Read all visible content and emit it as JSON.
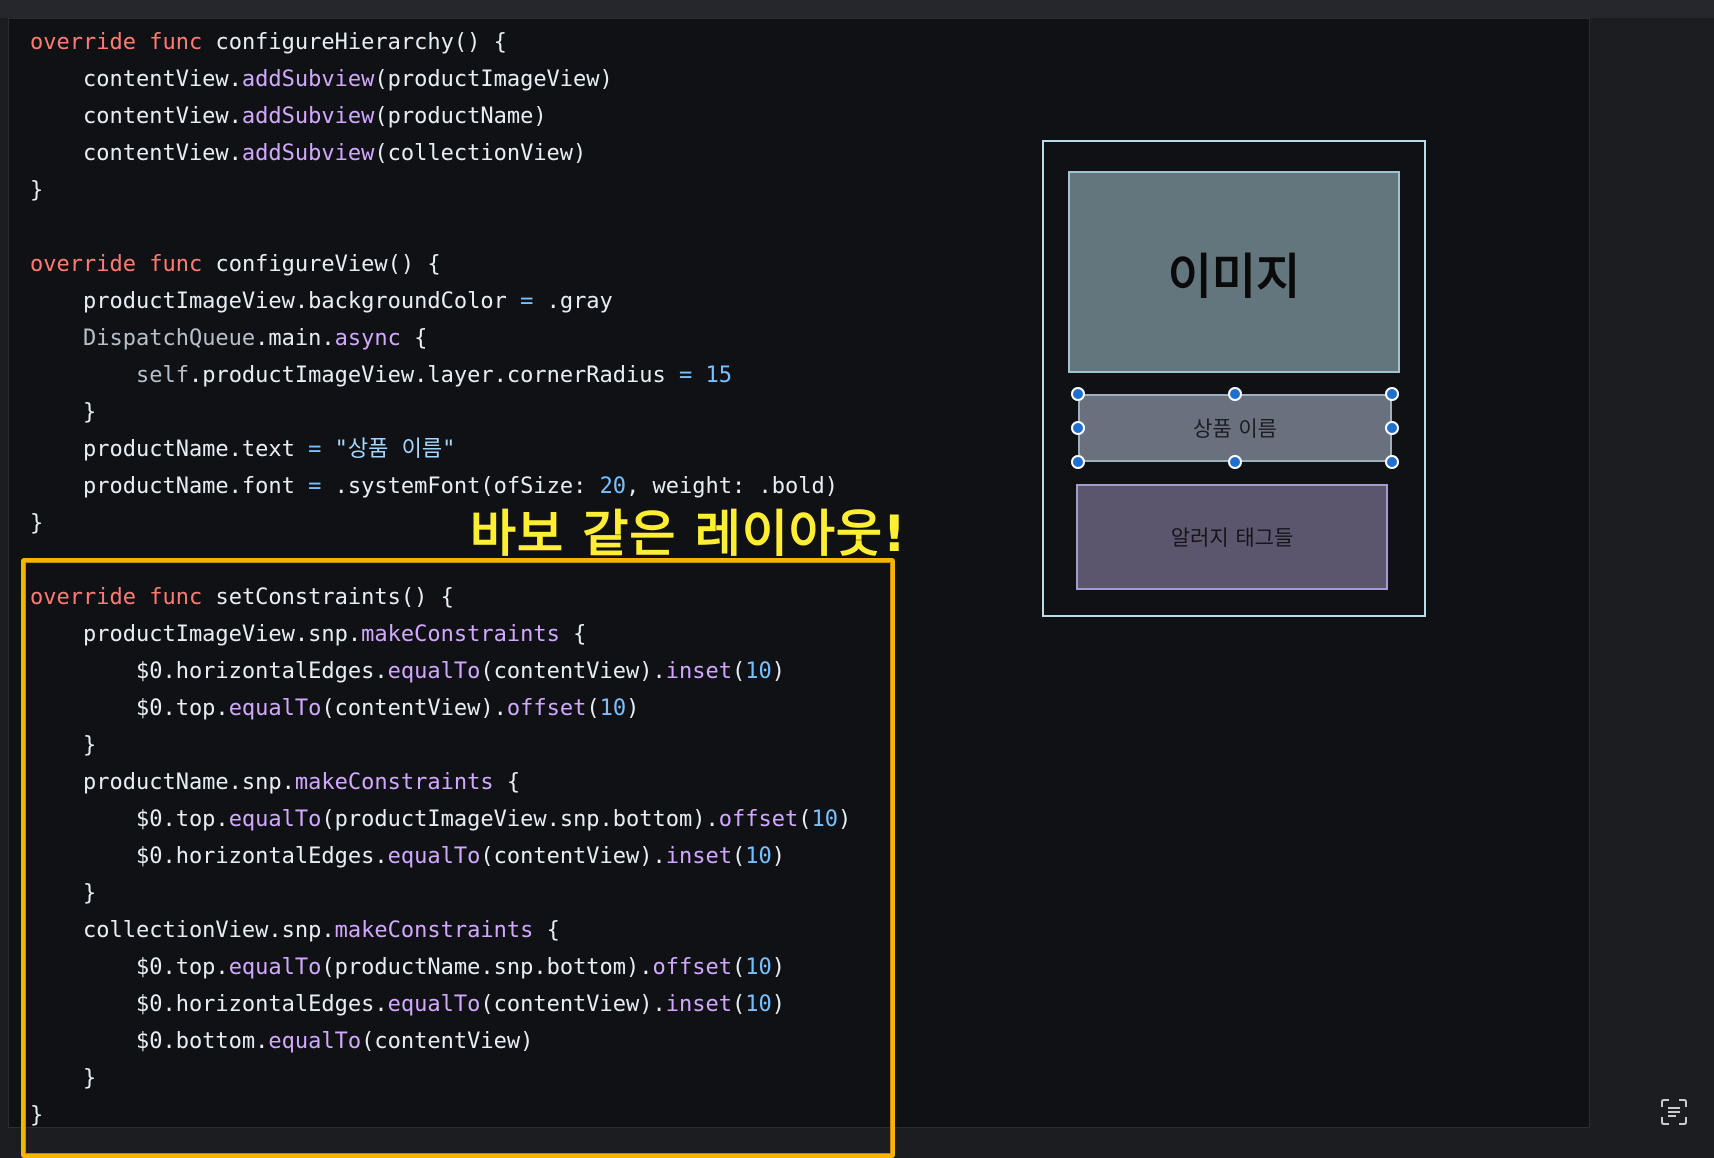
{
  "code_lines": [
    [
      [
        "kw",
        "override"
      ],
      [
        "t",
        " "
      ],
      [
        "kw",
        "func"
      ],
      [
        "t",
        " configureHierarchy() {"
      ]
    ],
    [
      [
        "t",
        "    contentView."
      ],
      [
        "fn",
        "addSubview"
      ],
      [
        "t",
        "(productImageView)"
      ]
    ],
    [
      [
        "t",
        "    contentView."
      ],
      [
        "fn",
        "addSubview"
      ],
      [
        "t",
        "(productName)"
      ]
    ],
    [
      [
        "t",
        "    contentView."
      ],
      [
        "fn",
        "addSubview"
      ],
      [
        "t",
        "(collectionView)"
      ]
    ],
    [
      [
        "t",
        "}"
      ]
    ],
    [
      [
        "t",
        ""
      ]
    ],
    [
      [
        "kw",
        "override"
      ],
      [
        "t",
        " "
      ],
      [
        "kw",
        "func"
      ],
      [
        "t",
        " configureView() {"
      ]
    ],
    [
      [
        "t",
        "    productImageView.backgroundColor "
      ],
      [
        "op",
        "="
      ],
      [
        "t",
        " .gray"
      ]
    ],
    [
      [
        "t",
        "    "
      ],
      [
        "sys",
        "DispatchQueue"
      ],
      [
        "t",
        ".main."
      ],
      [
        "fn",
        "async"
      ],
      [
        "t",
        " {"
      ]
    ],
    [
      [
        "t",
        "        "
      ],
      [
        "sys",
        "self"
      ],
      [
        "t",
        ".productImageView.layer.cornerRadius "
      ],
      [
        "op",
        "="
      ],
      [
        "t",
        " "
      ],
      [
        "num",
        "15"
      ]
    ],
    [
      [
        "t",
        "    }"
      ]
    ],
    [
      [
        "t",
        "    productName.text "
      ],
      [
        "op",
        "="
      ],
      [
        "t",
        " "
      ],
      [
        "str",
        "\"상품 이름\""
      ]
    ],
    [
      [
        "t",
        "    productName.font "
      ],
      [
        "op",
        "="
      ],
      [
        "t",
        " .systemFont(ofSize: "
      ],
      [
        "num",
        "20"
      ],
      [
        "t",
        ", weight: .bold)"
      ]
    ],
    [
      [
        "t",
        "}"
      ]
    ],
    [
      [
        "t",
        ""
      ]
    ],
    [
      [
        "kw",
        "override"
      ],
      [
        "t",
        " "
      ],
      [
        "kw",
        "func"
      ],
      [
        "t",
        " setConstraints() {"
      ]
    ],
    [
      [
        "t",
        "    productImageView.snp."
      ],
      [
        "fn",
        "makeConstraints"
      ],
      [
        "t",
        " {"
      ]
    ],
    [
      [
        "t",
        "        $0.horizontalEdges."
      ],
      [
        "fn",
        "equalTo"
      ],
      [
        "t",
        "(contentView)."
      ],
      [
        "fn",
        "inset"
      ],
      [
        "t",
        "("
      ],
      [
        "num",
        "10"
      ],
      [
        "t",
        ")"
      ]
    ],
    [
      [
        "t",
        "        $0.top."
      ],
      [
        "fn",
        "equalTo"
      ],
      [
        "t",
        "(contentView)."
      ],
      [
        "fn",
        "offset"
      ],
      [
        "t",
        "("
      ],
      [
        "num",
        "10"
      ],
      [
        "t",
        ")"
      ]
    ],
    [
      [
        "t",
        "    }"
      ]
    ],
    [
      [
        "t",
        "    productName.snp."
      ],
      [
        "fn",
        "makeConstraints"
      ],
      [
        "t",
        " {"
      ]
    ],
    [
      [
        "t",
        "        $0.top."
      ],
      [
        "fn",
        "equalTo"
      ],
      [
        "t",
        "(productImageView.snp.bottom)."
      ],
      [
        "fn",
        "offset"
      ],
      [
        "t",
        "("
      ],
      [
        "num",
        "10"
      ],
      [
        "t",
        ")"
      ]
    ],
    [
      [
        "t",
        "        $0.horizontalEdges."
      ],
      [
        "fn",
        "equalTo"
      ],
      [
        "t",
        "(contentView)."
      ],
      [
        "fn",
        "inset"
      ],
      [
        "t",
        "("
      ],
      [
        "num",
        "10"
      ],
      [
        "t",
        ")"
      ]
    ],
    [
      [
        "t",
        "    }"
      ]
    ],
    [
      [
        "t",
        "    collectionView.snp."
      ],
      [
        "fn",
        "makeConstraints"
      ],
      [
        "t",
        " {"
      ]
    ],
    [
      [
        "t",
        "        $0.top."
      ],
      [
        "fn",
        "equalTo"
      ],
      [
        "t",
        "(productName.snp.bottom)."
      ],
      [
        "fn",
        "offset"
      ],
      [
        "t",
        "("
      ],
      [
        "num",
        "10"
      ],
      [
        "t",
        ")"
      ]
    ],
    [
      [
        "t",
        "        $0.horizontalEdges."
      ],
      [
        "fn",
        "equalTo"
      ],
      [
        "t",
        "(contentView)."
      ],
      [
        "fn",
        "inset"
      ],
      [
        "t",
        "("
      ],
      [
        "num",
        "10"
      ],
      [
        "t",
        ")"
      ]
    ],
    [
      [
        "t",
        "        $0.bottom."
      ],
      [
        "fn",
        "equalTo"
      ],
      [
        "t",
        "(contentView)"
      ]
    ],
    [
      [
        "t",
        "    }"
      ]
    ],
    [
      [
        "t",
        "}"
      ]
    ]
  ],
  "callout": {
    "text": "바보 같은 레이아웃!"
  },
  "mockup": {
    "image_label": "이미지",
    "name_label": "상품 이름",
    "tags_label": "알러지 태그들"
  },
  "colors": {
    "keyword": "#ff7b72",
    "method": "#d2a8ff",
    "number": "#79c0ff",
    "highlight_border": "#f5b400",
    "callout_text": "#ffee33"
  },
  "icons": {
    "corner": "text-scan-icon"
  }
}
